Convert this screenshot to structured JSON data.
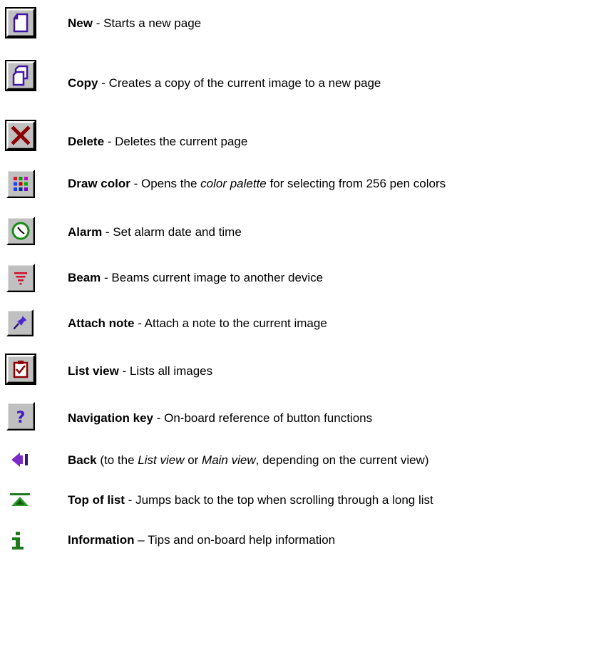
{
  "items": [
    {
      "icon": "new-page-icon",
      "name": "New",
      "sep": " - ",
      "text": "Starts a new page"
    },
    {
      "icon": "copy-page-icon",
      "name": "Copy",
      "sep": " - ",
      "text": "Creates a copy of the current image to a new page"
    },
    {
      "icon": "delete-x-icon",
      "name": "Delete",
      "sep": " - ",
      "text": "Deletes the current page"
    },
    {
      "icon": "color-grid-icon",
      "name": "Draw color",
      "sep": " - ",
      "text_a": "Opens the ",
      "text_em": "color palette",
      "text_b": " for selecting from 256 pen colors"
    },
    {
      "icon": "alarm-clock-icon",
      "name": "Alarm",
      "sep": " - ",
      "text": "Set alarm date and time"
    },
    {
      "icon": "beam-icon",
      "name": "Beam",
      "sep": " - ",
      "text": "Beams current image to another device"
    },
    {
      "icon": "pushpin-icon",
      "name": "Attach note",
      "sep": " - ",
      "text": "Attach a note to the current image"
    },
    {
      "icon": "clipboard-check-icon",
      "name": "List view",
      "sep": " - ",
      "text": "Lists all images"
    },
    {
      "icon": "question-mark-icon",
      "name": "Navigation key",
      "sep": " - ",
      "text": "On-board reference of button functions"
    },
    {
      "icon": "back-arrow-icon",
      "name": "Back",
      "text_a": " (to the ",
      "em1": "List view",
      "text_b": " or ",
      "em2": "Main view",
      "text_c": ", depending on the current view)"
    },
    {
      "icon": "top-of-list-icon",
      "name": "Top of list",
      "sep": " - ",
      "text": "Jumps back to the top when scrolling through a long list"
    },
    {
      "icon": "info-icon",
      "name": "Information",
      "sep": " – ",
      "text": "Tips and on-board help information"
    }
  ],
  "colors": {
    "button_face": "#c0c0c0",
    "icon_purple": "#3f17a8",
    "icon_red": "#8b0000",
    "icon_green": "#1a8a1a",
    "back_arrow": "#7b2cc8",
    "top_green": "#1f7a1f"
  }
}
